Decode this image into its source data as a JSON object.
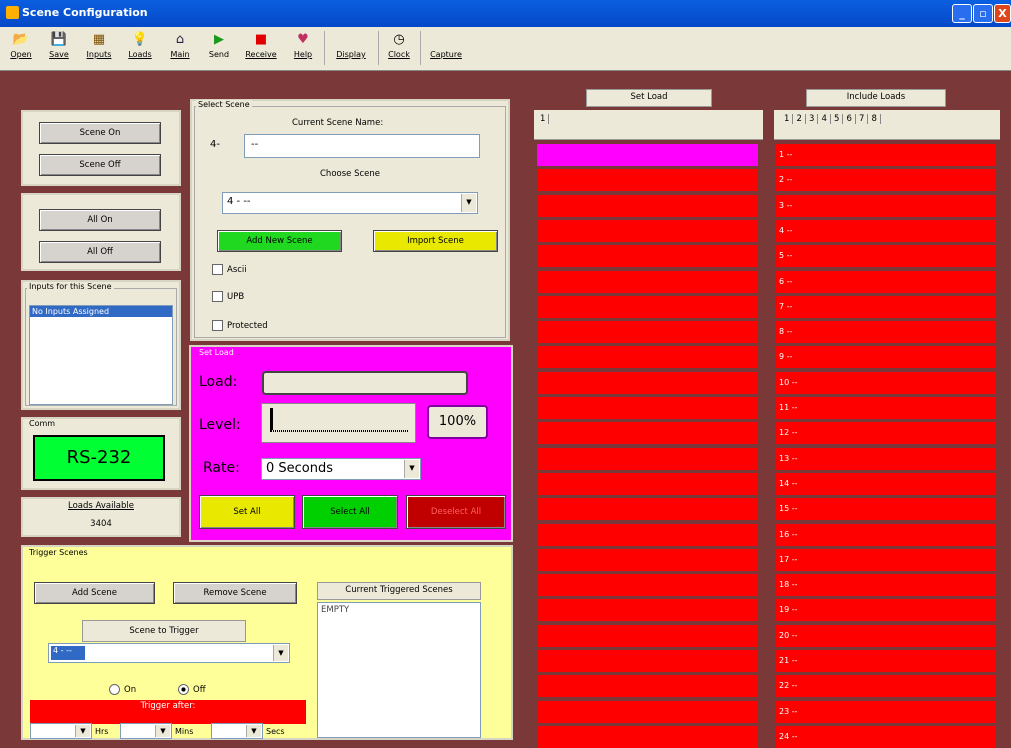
{
  "window": {
    "title": "Scene Configuration",
    "buttons": [
      "_",
      "▫",
      "X"
    ]
  },
  "toolbar": {
    "items": [
      {
        "label": "Open",
        "icon": "folder-open-icon",
        "glyph": "📂"
      },
      {
        "label": "Save",
        "icon": "floppy-disk-icon",
        "glyph": "💾"
      },
      {
        "label": "Inputs",
        "icon": "keypad-icon",
        "glyph": "▦"
      },
      {
        "label": "Loads",
        "icon": "light-bulb-icon",
        "glyph": "💡"
      },
      {
        "label": "Main",
        "icon": "house-icon",
        "glyph": "⌂"
      },
      {
        "label": "Send",
        "icon": "send-arrow-icon",
        "glyph": "▶"
      },
      {
        "label": "Receive",
        "icon": "receive-icon",
        "glyph": "■"
      },
      {
        "label": "Help",
        "icon": "help-heart-icon",
        "glyph": "♥"
      },
      {
        "label": "Display",
        "icon": "",
        "glyph": ""
      },
      {
        "label": "Clock",
        "icon": "clock-icon",
        "glyph": "◷"
      },
      {
        "label": "Capture",
        "icon": "",
        "glyph": ""
      }
    ]
  },
  "scene_buttons": {
    "on": "Scene On",
    "off": "Scene Off"
  },
  "all_buttons": {
    "on": "All On",
    "off": "All Off"
  },
  "inputs": {
    "legend": "Inputs for this Scene",
    "items": [
      "No Inputs Assigned"
    ]
  },
  "comm": {
    "legend": "Comm",
    "value": "RS-232",
    "color": "#00ff33"
  },
  "loads_available": {
    "label": "Loads Available",
    "value": "3404"
  },
  "select_scene": {
    "legend": "Select Scene",
    "name_label": "Current Scene Name:",
    "number": "4-",
    "name_value": "--",
    "choose_label": "Choose Scene",
    "choose_value": "4 - --",
    "add_btn": "Add New Scene",
    "import_btn": "Import Scene",
    "checks": [
      "Ascii",
      "UPB",
      "Protected"
    ]
  },
  "set_load": {
    "legend": "Set Load",
    "load_label": "Load:",
    "level_label": "Level:",
    "level_value": "100%",
    "level_fraction": 1.0,
    "rate_label": "Rate:",
    "rate_value": "0 Seconds",
    "set_all": "Set All",
    "select_all": "Select All",
    "deselect_all": "Deselect All",
    "bg": "#ff00ff"
  },
  "trigger": {
    "legend": "Trigger Scenes",
    "add": "Add Scene",
    "remove": "Remove Scene",
    "current_label": "Current Triggered Scenes",
    "current_value": "EMPTY",
    "scene_to_trigger": "Scene to Trigger",
    "combo_value": "4 - --",
    "on": "On",
    "off": "Off",
    "trigger_after": "Trigger after:",
    "hrs": "Hrs",
    "mins": "Mins",
    "secs": "Secs"
  },
  "set_load_col": {
    "header": "Set Load",
    "tab": "1"
  },
  "include_loads": {
    "header": "Include Loads",
    "tabs": [
      "1",
      "2",
      "3",
      "4",
      "5",
      "6",
      "7",
      "8"
    ],
    "rows": [
      "1 --",
      "2 --",
      "3 --",
      "4 --",
      "5 --",
      "6 --",
      "7 --",
      "8 --",
      "9 --",
      "10 --",
      "11 --",
      "12 --",
      "13 --",
      "14 --",
      "15 --",
      "16 --",
      "17 --",
      "18 --",
      "19 --",
      "20 --",
      "21 --",
      "22 --",
      "23 --",
      "24 --"
    ]
  }
}
